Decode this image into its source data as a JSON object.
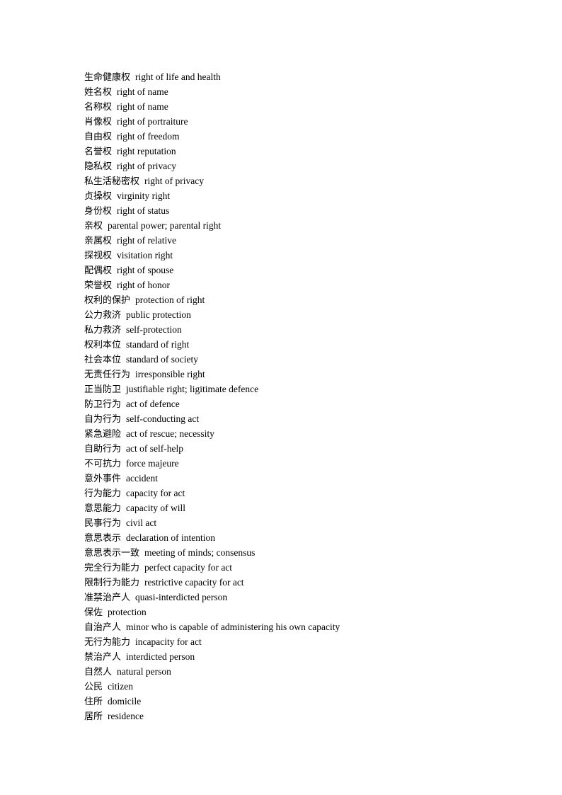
{
  "document": {
    "background_color": "#ffffff",
    "highlight_color": "#ffff00",
    "text_color": "#000000",
    "entries": [
      {
        "term": "生命健康权",
        "gloss": "right of life and health",
        "highlighted": false
      },
      {
        "term": "姓名权",
        "gloss": "right of name",
        "highlighted": false
      },
      {
        "term": "名称权",
        "gloss": "right of name",
        "highlighted": false
      },
      {
        "term": "肖像权",
        "gloss": "right of portraiture",
        "highlighted": false
      },
      {
        "term": "自由权",
        "gloss": "right of freedom",
        "highlighted": false
      },
      {
        "term": "名誉权",
        "gloss": "right reputation",
        "highlighted": false
      },
      {
        "term": "隐私权",
        "gloss": "right of privacy",
        "highlighted": false
      },
      {
        "term": "私生活秘密权",
        "gloss": "right of privacy",
        "highlighted": false
      },
      {
        "term": "贞操权",
        "gloss": "virginity right",
        "highlighted": false
      },
      {
        "term": "身份权",
        "gloss": "right of status",
        "highlighted": false
      },
      {
        "term": "亲权",
        "gloss": "parental power; parental right",
        "highlighted": false
      },
      {
        "term": "亲属权",
        "gloss": "right of relative",
        "highlighted": false
      },
      {
        "term": "探视权",
        "gloss": "visitation right",
        "highlighted": false
      },
      {
        "term": "配偶权",
        "gloss": "right of spouse",
        "highlighted": false
      },
      {
        "term": "荣誉权",
        "gloss": "right of honor",
        "highlighted": false
      },
      {
        "term": "权利的保护",
        "gloss": "protection of right",
        "highlighted": false
      },
      {
        "term": "公力救济",
        "gloss": "public protection",
        "highlighted": false
      },
      {
        "term": "私力救济",
        "gloss": "self-protection",
        "highlighted": false
      },
      {
        "term": "权利本位",
        "gloss": "standard of right",
        "highlighted": false
      },
      {
        "term": "社会本位",
        "gloss": "standard of society",
        "highlighted": false
      },
      {
        "term": "无责任行为",
        "gloss": "irresponsible right",
        "highlighted": false
      },
      {
        "term": "正当防卫",
        "gloss": "justifiable right; ligitimate defence",
        "highlighted": false
      },
      {
        "term": "防卫行为",
        "gloss": "act of defence",
        "highlighted": false
      },
      {
        "term": "自为行为",
        "gloss": "self-conducting act",
        "highlighted": false
      },
      {
        "term": "紧急避险",
        "gloss": "act of rescue; necessity",
        "highlighted": false
      },
      {
        "term": "自助行为",
        "gloss": "act of self-help",
        "highlighted": false
      },
      {
        "term": "不可抗力",
        "gloss": "force majeure",
        "highlighted": false
      },
      {
        "term": "意外事件",
        "gloss": "accident",
        "highlighted": false
      },
      {
        "term": "行为能力",
        "gloss": "capacity for act",
        "highlighted": true
      },
      {
        "term": "意思能力",
        "gloss": "capacity of will",
        "highlighted": true
      },
      {
        "term": "民事行为",
        "gloss": "civil act",
        "highlighted": true
      },
      {
        "term": "意思表示",
        "gloss": "declaration of intention",
        "highlighted": true
      },
      {
        "term": "意思表示一致",
        "gloss": "meeting of minds; consensus",
        "highlighted": true
      },
      {
        "term": "完全行为能力",
        "gloss": "perfect capacity for act",
        "highlighted": true
      },
      {
        "term": "限制行为能力",
        "gloss": "restrictive capacity for act",
        "highlighted": true
      },
      {
        "term": "准禁治产人",
        "gloss": "quasi-interdicted person",
        "highlighted": false
      },
      {
        "term": "保佐",
        "gloss": "protection",
        "highlighted": false
      },
      {
        "term": "自治产人",
        "gloss": "minor who is capable of administering his own capacity",
        "highlighted": false
      },
      {
        "term": "无行为能力",
        "gloss": "incapacity for act",
        "highlighted": true
      },
      {
        "term": "禁治产人",
        "gloss": "interdicted person",
        "highlighted": false
      },
      {
        "term": "自然人",
        "gloss": "natural person",
        "highlighted": true
      },
      {
        "term": "公民",
        "gloss": "citizen",
        "highlighted": true
      },
      {
        "term": "住所",
        "gloss": "domicile",
        "highlighted": false
      },
      {
        "term": "居所",
        "gloss": "residence",
        "highlighted": false
      }
    ]
  }
}
